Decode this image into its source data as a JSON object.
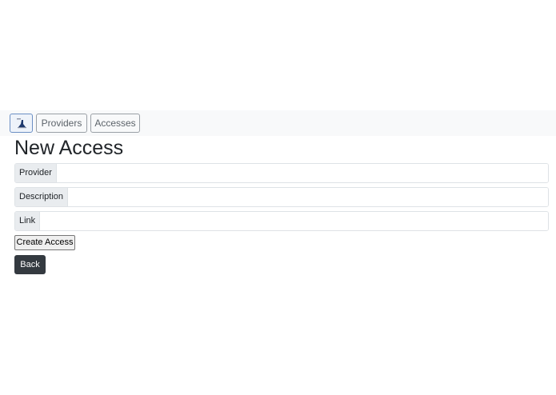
{
  "navbar": {
    "home_icon": "logo-icon",
    "items": [
      {
        "label": "Providers"
      },
      {
        "label": "Accesses"
      }
    ]
  },
  "page": {
    "title": "New Access"
  },
  "form": {
    "fields": [
      {
        "label": "Provider",
        "value": "",
        "placeholder": ""
      },
      {
        "label": "Description",
        "value": "",
        "placeholder": ""
      },
      {
        "label": "Link",
        "value": "",
        "placeholder": ""
      }
    ],
    "submit_label": "Create Access"
  },
  "actions": {
    "back_label": "Back"
  },
  "colors": {
    "navbar_bg": "#f8f9fa",
    "back_button_bg": "#343a40",
    "label_bg": "#e9ecef"
  }
}
